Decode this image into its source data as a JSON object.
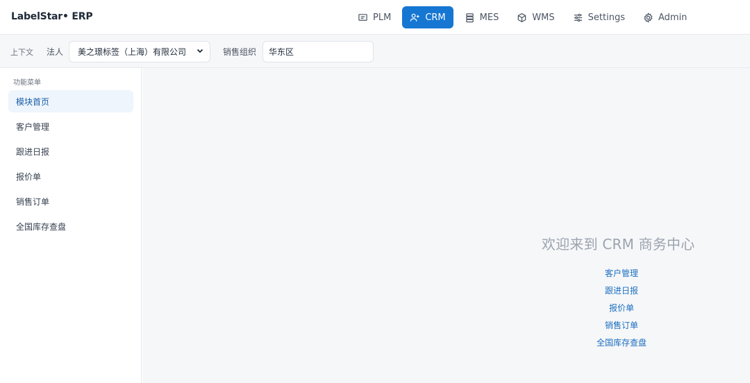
{
  "brand": {
    "name": "LabelStar• ERP"
  },
  "nav": {
    "active": "CRM",
    "accent_color": "#1677d2",
    "items": [
      {
        "label": "PLM",
        "icon": "monitor-icon"
      },
      {
        "label": "CRM",
        "icon": "user-plus-icon"
      },
      {
        "label": "MES",
        "icon": "server-icon"
      },
      {
        "label": "WMS",
        "icon": "cube-icon"
      },
      {
        "label": "Settings",
        "icon": "sliders-icon"
      },
      {
        "label": "Admin",
        "icon": "gear-icon"
      }
    ]
  },
  "context": {
    "label": "上下文",
    "legal_entity": {
      "label": "法人",
      "value": "美之璟标签（上海）有限公司"
    },
    "sales_org": {
      "label": "销售组织",
      "value": "华东区"
    }
  },
  "sidebar": {
    "title": "功能菜单",
    "items": [
      {
        "label": "模块首页",
        "active": true
      },
      {
        "label": "客户管理",
        "active": false
      },
      {
        "label": "跟进日报",
        "active": false
      },
      {
        "label": "报价单",
        "active": false
      },
      {
        "label": "销售订单",
        "active": false
      },
      {
        "label": "全国库存查盘",
        "active": false
      }
    ]
  },
  "main": {
    "welcome": "欢迎来到 CRM 商务中心",
    "links": [
      "客户管理",
      "跟进日报",
      "报价单",
      "销售订单",
      "全国库存查盘"
    ]
  }
}
